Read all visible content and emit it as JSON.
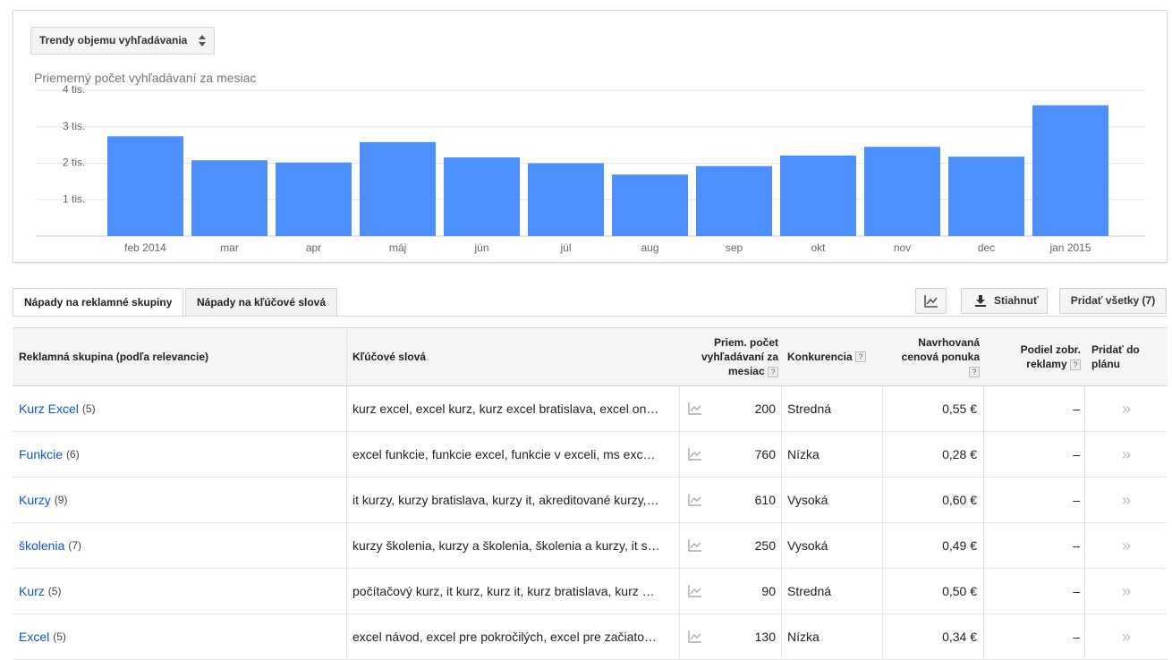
{
  "metric_selector": {
    "label": "Trendy objemu vyhľadávania"
  },
  "chart_subtitle": "Priemerný počet vyhľadávaní za mesiac",
  "chart_data": {
    "type": "bar",
    "categories": [
      "feb 2014",
      "mar",
      "apr",
      "máj",
      "jún",
      "júl",
      "aug",
      "sep",
      "okt",
      "nov",
      "dec",
      "jan 2015"
    ],
    "values": [
      2740,
      2080,
      2020,
      2580,
      2160,
      2000,
      1690,
      1920,
      2210,
      2450,
      2180,
      3590
    ],
    "y_ticks": [
      "1 tis.",
      "2 tis.",
      "3 tis.",
      "4 tis."
    ],
    "ylim": [
      0,
      4000
    ],
    "color": "#4d8ffc",
    "grid": true
  },
  "tabs": [
    {
      "label": "Nápady na reklamné skupiny",
      "active": true
    },
    {
      "label": "Nápady na kľúčové slová",
      "active": false
    }
  ],
  "toolbar": {
    "download_label": "Stiahnuť",
    "add_all_label": "Pridať všetky (7)"
  },
  "columns": {
    "group": "Reklamná skupina (podľa relevancie)",
    "keywords": "Kľúčové slová",
    "avg_searches": "Priem. počet vyhľadávaní za mesiac",
    "competition": "Konkurencia",
    "suggested_bid": "Navrhovaná cenová ponuka",
    "ad_share": "Podiel zobr. reklamy",
    "add_to_plan": "Pridať do plánu",
    "help": "?"
  },
  "rows": [
    {
      "group": "Kurz Excel",
      "count": "(5)",
      "keywords": "kurz excel, excel kurz, kurz excel bratislava, excel on…",
      "searches": "200",
      "competition": "Stredná",
      "bid": "0,55 €",
      "share": "–"
    },
    {
      "group": "Funkcie",
      "count": "(6)",
      "keywords": "excel funkcie, funkcie excel, funkcie v exceli, ms exc…",
      "searches": "760",
      "competition": "Nízka",
      "bid": "0,28 €",
      "share": "–"
    },
    {
      "group": "Kurzy",
      "count": "(9)",
      "keywords": "it kurzy, kurzy bratislava, kurzy it, akreditované kurzy,…",
      "searches": "610",
      "competition": "Vysoká",
      "bid": "0,60 €",
      "share": "–"
    },
    {
      "group": "školenia",
      "count": "(7)",
      "keywords": "kurzy školenia, kurzy a školenia, školenia a kurzy, it s…",
      "searches": "250",
      "competition": "Vysoká",
      "bid": "0,49 €",
      "share": "–"
    },
    {
      "group": "Kurz",
      "count": "(5)",
      "keywords": "počítačový kurz, it kurz, kurz it, kurz bratislava, kurz …",
      "searches": "90",
      "competition": "Stredná",
      "bid": "0,50 €",
      "share": "–"
    },
    {
      "group": "Excel",
      "count": "(5)",
      "keywords": "excel návod, excel pre pokročilých, excel pre začiato…",
      "searches": "130",
      "competition": "Nízka",
      "bid": "0,34 €",
      "share": "–"
    }
  ],
  "add_arrow": "»"
}
